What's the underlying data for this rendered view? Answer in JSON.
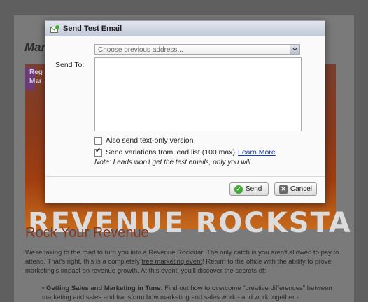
{
  "background": {
    "title": "Mar",
    "hero_tag_lines": [
      "Reg",
      "Mar"
    ],
    "hero_text": "REVENUE ROCKSTAR",
    "heading": "Rock Your Revenue",
    "paragraph_before_link": "We're taking to the road to turn you into a Revenue Rockstar. The only catch is you aren't allowed to pay to attend. That's right, this is a completely ",
    "paragraph_link": "free marketing event",
    "paragraph_after_link": "! Return to the office with the ability to prove marketing's impact on revenue growth. At this event, you'll discover the secrets of:",
    "bullet_bold": "Getting Sales and Marketing in Tune:",
    "bullet_text": " Find out how to overcome \"creative differences\" between marketing and sales and transform how marketing and sales work - and work together -"
  },
  "dialog": {
    "title": "Send Test Email",
    "send_to_label": "Send To:",
    "address_placeholder": "Choose previous address...",
    "recipients_value": "",
    "text_only_label": "Also send text-only version",
    "text_only_checked": false,
    "variations_label": "Send variations from lead list (100 max)",
    "variations_checked": true,
    "learn_more_label": "Learn More",
    "note": "Note: Leads won't get the test emails, only you will",
    "send_button": "Send",
    "cancel_button": "Cancel"
  },
  "colors": {
    "send_icon": "#46a83a",
    "link": "#1a3fb0",
    "heading": "#8a3418"
  },
  "icons": {
    "title": "email-icon",
    "send": "check-circle-icon",
    "cancel": "close-box-icon",
    "dropdown": "chevron-down-icon"
  }
}
